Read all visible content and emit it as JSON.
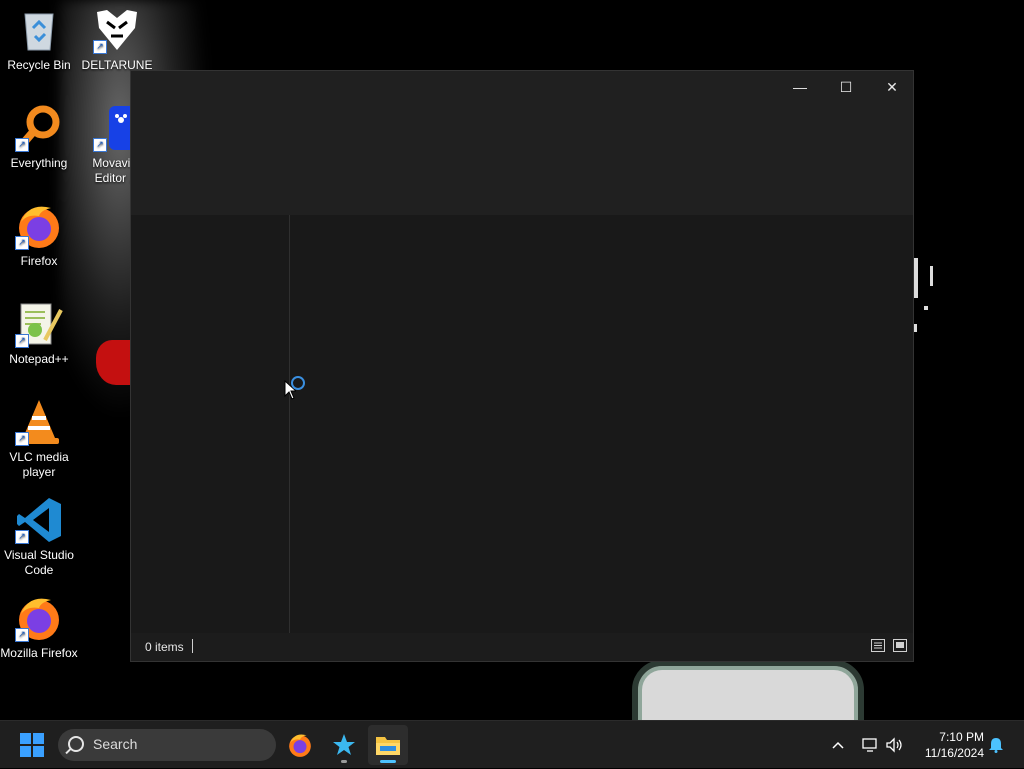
{
  "desktop": {
    "icons": [
      {
        "label": "Recycle Bin",
        "icon": "recycle-bin-icon"
      },
      {
        "label": "DELTARUNE",
        "icon": "deltarune-icon"
      },
      {
        "label": "Everything",
        "icon": "everything-search-icon"
      },
      {
        "label": "Movavi V\nEditor ...",
        "icon": "movavi-video-editor-icon"
      },
      {
        "label": "Firefox",
        "icon": "firefox-icon"
      },
      {
        "label": "Notepad++",
        "icon": "notepad-plus-plus-icon"
      },
      {
        "label": "VLC media player",
        "icon": "vlc-icon"
      },
      {
        "label": "Visual Studio Code",
        "icon": "vscode-icon"
      },
      {
        "label": "Mozilla Firefox",
        "icon": "firefox-icon"
      }
    ]
  },
  "window": {
    "controls": {
      "minimize": "—",
      "maximize": "☐",
      "close": "✕"
    },
    "status": {
      "item_count": "0 items"
    }
  },
  "taskbar": {
    "search_placeholder": "Search",
    "apps": [
      {
        "name": "firefox",
        "icon": "firefox-icon",
        "active": false
      },
      {
        "name": "starred-app",
        "icon": "star-icon",
        "active": false
      },
      {
        "name": "file-explorer",
        "icon": "folder-icon",
        "active": true
      }
    ],
    "clock": {
      "time": "7:10 PM",
      "date": "11/16/2024"
    }
  },
  "colors": {
    "accent": "#3aa0ff",
    "window_bg": "#1c1c1c",
    "taskbar_bg": "#1f1f1f"
  }
}
